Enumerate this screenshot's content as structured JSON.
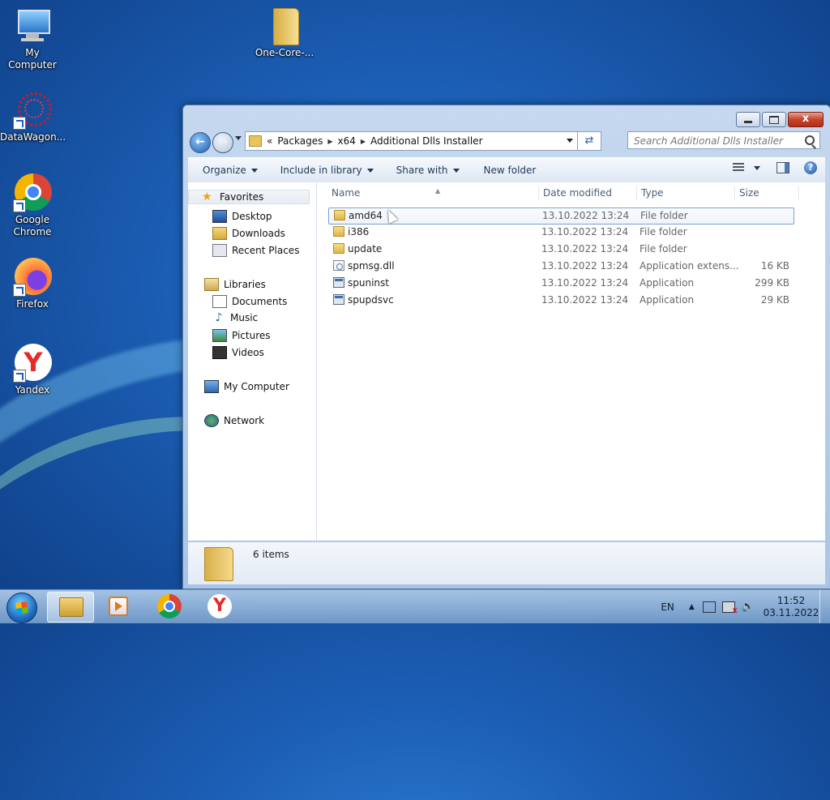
{
  "desktop": {
    "icons": [
      {
        "label": "My Computer"
      },
      {
        "label": "One-Core-..."
      },
      {
        "label": "DataWagon..."
      },
      {
        "label": "Google Chrome"
      },
      {
        "label": "Firefox"
      },
      {
        "label": "Yandex"
      }
    ]
  },
  "window": {
    "breadcrumb": [
      "Packages",
      "x64",
      "Additional Dlls Installer"
    ],
    "breadcrumb_prefix": "«",
    "search_placeholder": "Search Additional Dlls Installer",
    "toolbar": {
      "organize": "Organize",
      "include_in_library": "Include in library",
      "share_with": "Share with",
      "new_folder": "New folder"
    },
    "nav": {
      "favorites": "Favorites",
      "desktop": "Desktop",
      "downloads": "Downloads",
      "recent_places": "Recent Places",
      "libraries": "Libraries",
      "documents": "Documents",
      "music": "Music",
      "pictures": "Pictures",
      "videos": "Videos",
      "my_computer": "My Computer",
      "network": "Network"
    },
    "columns": {
      "name": "Name",
      "date": "Date modified",
      "type": "Type",
      "size": "Size"
    },
    "files": [
      {
        "name": "amd64",
        "date": "13.10.2022 13:24",
        "type": "File folder",
        "size": "",
        "icon": "folder-icon"
      },
      {
        "name": "i386",
        "date": "13.10.2022 13:24",
        "type": "File folder",
        "size": "",
        "icon": "folder-icon"
      },
      {
        "name": "update",
        "date": "13.10.2022 13:24",
        "type": "File folder",
        "size": "",
        "icon": "folder-icon"
      },
      {
        "name": "spmsg.dll",
        "date": "13.10.2022 13:24",
        "type": "Application extens...",
        "size": "16 KB",
        "icon": "dll-file-icon"
      },
      {
        "name": "spuninst",
        "date": "13.10.2022 13:24",
        "type": "Application",
        "size": "299 KB",
        "icon": "application-icon"
      },
      {
        "name": "spupdsvc",
        "date": "13.10.2022 13:24",
        "type": "Application",
        "size": "29 KB",
        "icon": "application-icon"
      }
    ],
    "status": "6 items",
    "close_label": "x"
  },
  "taskbar": {
    "language": "EN",
    "time": "11:52",
    "date": "03.11.2022"
  }
}
